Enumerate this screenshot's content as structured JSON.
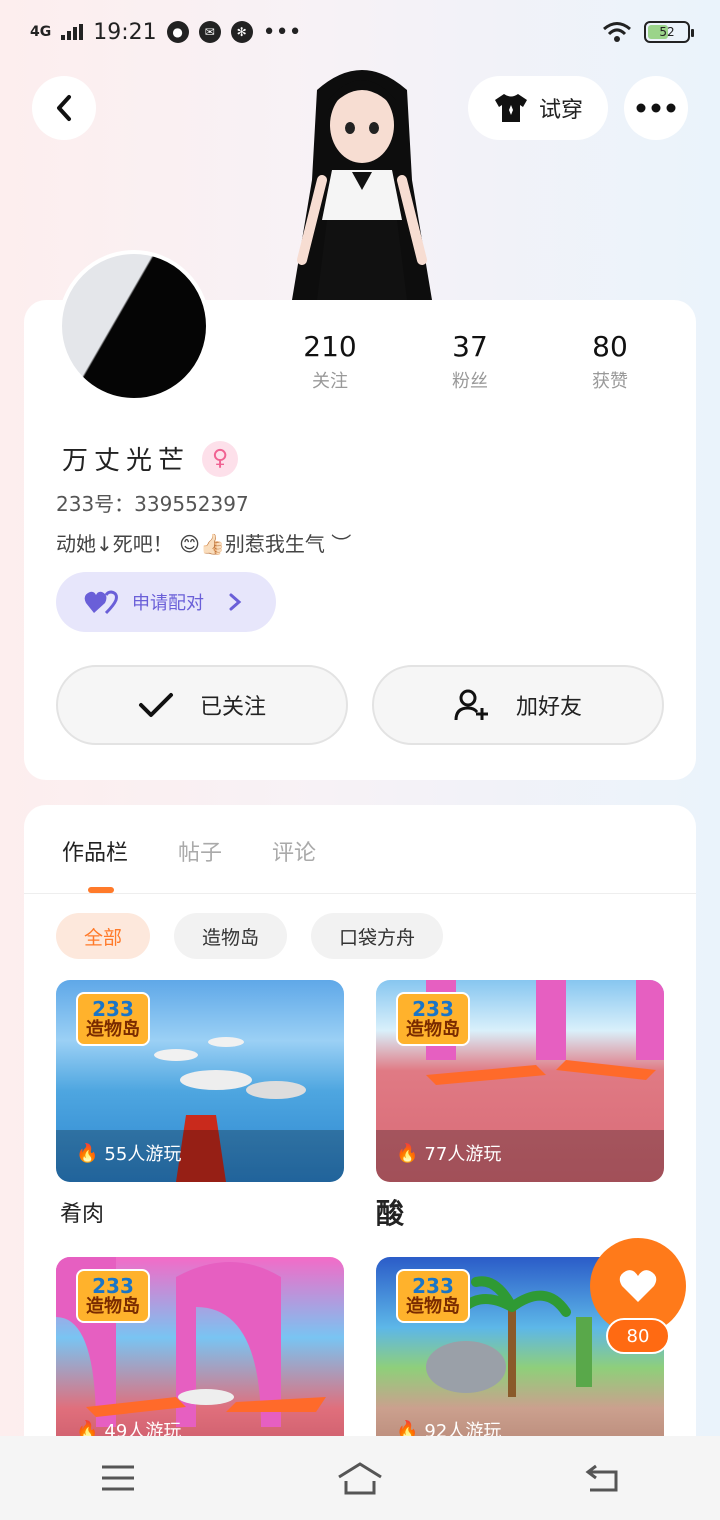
{
  "status_bar": {
    "network": "4G",
    "time": "19:21",
    "more": "•••",
    "battery": "52",
    "battery_level": 0.52
  },
  "header": {
    "back_icon": "chevron-left-icon",
    "tryon_label": "试穿",
    "more_icon": "more-dots-icon"
  },
  "profile": {
    "stats": [
      {
        "value": "210",
        "label": "关注"
      },
      {
        "value": "37",
        "label": "粉丝"
      },
      {
        "value": "80",
        "label": "获赞"
      }
    ],
    "username": "万丈光芒",
    "gender_icon": "female-icon",
    "gender_glyph": "♀",
    "account": "233号：339552397",
    "bio": "动她↓死吧！ 😊👍🏻别惹我生气 ︶",
    "pair_button": "申请配对",
    "follow_button": "已关注",
    "add_friend_button": "加好友"
  },
  "works": {
    "tabs": [
      "作品栏",
      "帖子",
      "评论"
    ],
    "active_tab": 0,
    "chips": [
      "全部",
      "造物岛",
      "口袋方舟"
    ],
    "active_chip": 0,
    "games": [
      {
        "logo": "233",
        "logo_text": "造物岛",
        "plays": "55人游玩",
        "title": "肴肉"
      },
      {
        "logo": "233",
        "logo_text": "造物岛",
        "plays": "77人游玩",
        "title": "酸"
      },
      {
        "logo": "233",
        "logo_text": "造物岛",
        "plays": "49人游玩",
        "title": ""
      },
      {
        "logo": "233",
        "logo_text": "造物岛",
        "plays": "92人游玩",
        "title": ""
      }
    ]
  },
  "like": {
    "count": "80"
  },
  "colors": {
    "accent": "#ff7a1a",
    "pair": "#6a5fd8"
  }
}
